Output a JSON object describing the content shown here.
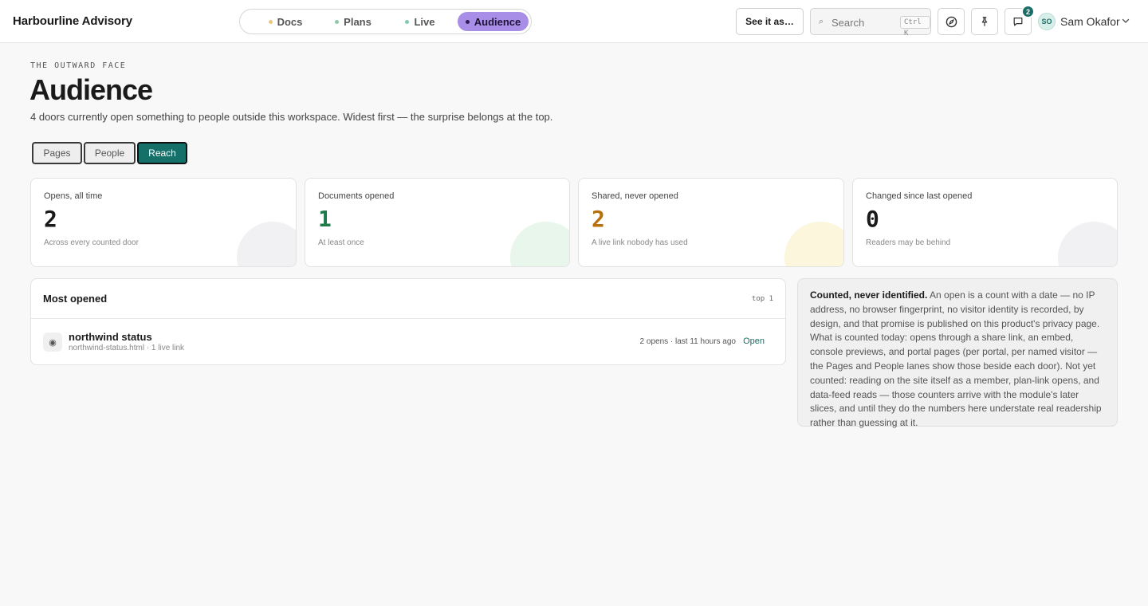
{
  "app": {
    "brand": "Harbourline Advisory"
  },
  "nav": {
    "tabs": [
      {
        "label": "Docs",
        "dot": "#e8c87a",
        "active": false
      },
      {
        "label": "Plans",
        "dot": "#8fc8a8",
        "active": false
      },
      {
        "label": "Live",
        "dot": "#7fc9b0",
        "active": false
      },
      {
        "label": "Audience",
        "dot": "#2d1c55",
        "active": true
      }
    ],
    "active_color": "#a98ee8"
  },
  "toolbar": {
    "see_as_label": "See it as…",
    "search_placeholder": "Search",
    "search_shortcut": "Ctrl K",
    "compass_icon": "compass-icon",
    "pin_icon": "pin-icon",
    "comments_icon": "comment-icon",
    "comments_count": "2",
    "user_initials": "SO",
    "user_name": "Sam Okafor"
  },
  "header": {
    "eyebrow": "THE OUTWARD FACE",
    "title": "Audience",
    "subtitle": "4 doors currently open something to people outside this workspace. Widest first — the surprise belongs at the top."
  },
  "segments": [
    {
      "label": "Pages",
      "active": false
    },
    {
      "label": "People",
      "active": false
    },
    {
      "label": "Reach",
      "active": true
    }
  ],
  "stats": [
    {
      "label": "Opens, all time",
      "value": "2",
      "note": "Across every counted door",
      "color": "#1a1a1a",
      "deco": "#f1f1f3"
    },
    {
      "label": "Documents opened",
      "value": "1",
      "note": "At least once",
      "color": "#1f7a4a",
      "deco": "#e9f6ec"
    },
    {
      "label": "Shared, never opened",
      "value": "2",
      "note": "A live link nobody has used",
      "color": "#b8700a",
      "deco": "#fbf6dc"
    },
    {
      "label": "Changed since last opened",
      "value": "0",
      "note": "Readers may be behind",
      "color": "#1a1a1a",
      "deco": "#f1f1f3"
    }
  ],
  "most_opened": {
    "title": "Most opened",
    "tag": "top 1",
    "rows": [
      {
        "icon": "radio-icon",
        "name": "northwind status",
        "sub": "northwind-status.html · 1 live link",
        "meta": "2 opens · last 11 hours ago",
        "action": "Open"
      }
    ]
  },
  "note": {
    "lead": "Counted, never identified.",
    "body": " An open is a count with a date — no IP address, no browser fingerprint, no visitor identity is recorded, by design, and that promise is published on this product's privacy page. What is counted today: opens through a share link, an embed, console previews, and portal pages (per portal, per named visitor — the Pages and People lanes show those beside each door). Not yet counted: reading on the site itself as a member, plan-link opens, and data-feed reads — those counters arrive with the module's later slices, and until they do the numbers here understate real readership rather than guessing at it."
  }
}
